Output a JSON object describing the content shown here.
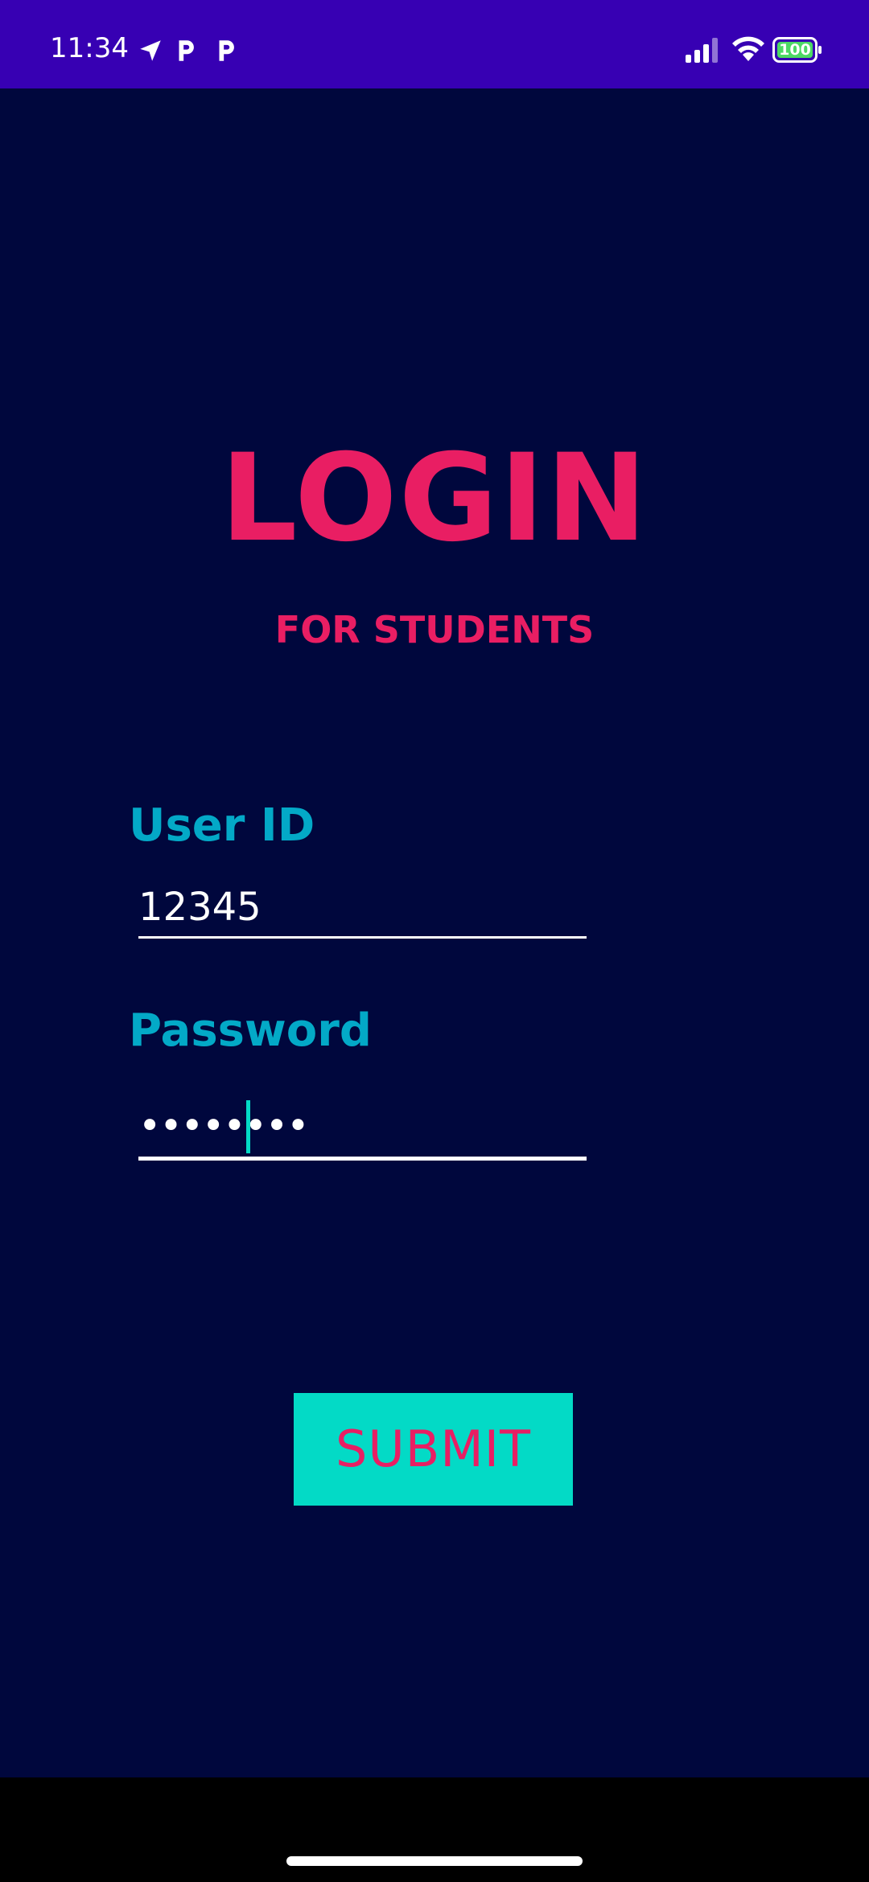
{
  "status_bar": {
    "time": "11:34",
    "battery_level": "100",
    "left_icons": [
      "navigation-arrow-icon",
      "parking-p-icon",
      "parking-p-icon"
    ],
    "right_icons": [
      "signal-bars-icon",
      "wifi-icon",
      "battery-icon"
    ],
    "background_color": "#3700b3"
  },
  "login": {
    "title": "LOGIN",
    "subtitle": "FOR STUDENTS",
    "user_id_label": "User ID",
    "user_id_value": "12345",
    "password_label": "Password",
    "password_value": "••••••••",
    "submit_label": "SUBMIT",
    "colors": {
      "background": "#00073d",
      "title": "#e91e63",
      "label": "#03a9c7",
      "button_bg": "#03dac6",
      "button_text": "#e91e63"
    }
  }
}
